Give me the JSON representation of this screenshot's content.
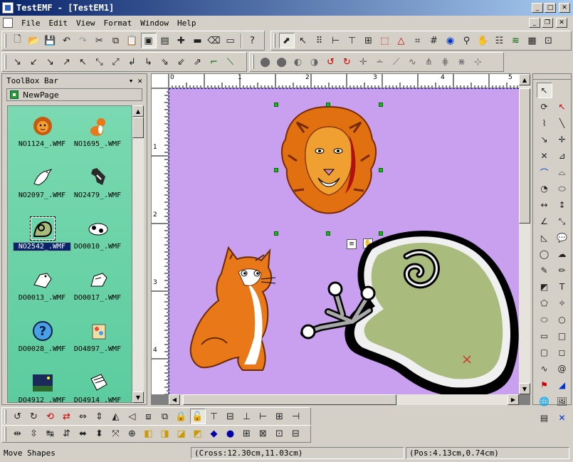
{
  "window": {
    "title": "TestEMF - [TestEM1]"
  },
  "menu": [
    {
      "key": "file",
      "label": "File"
    },
    {
      "key": "edit",
      "label": "Edit"
    },
    {
      "key": "view",
      "label": "View"
    },
    {
      "key": "format",
      "label": "Format"
    },
    {
      "key": "window",
      "label": "Window"
    },
    {
      "key": "help",
      "label": "Help"
    }
  ],
  "toolbox": {
    "title": "ToolBox Bar",
    "page_tab": "NewPage",
    "items": [
      {
        "label": "NO1124_.WMF",
        "icon": "lion-icon",
        "selected": false
      },
      {
        "label": "NO1695_.WMF",
        "icon": "cat-icon",
        "selected": false
      },
      {
        "label": "NO2097_.WMF",
        "icon": "bird-icon",
        "selected": false
      },
      {
        "label": "NO2479_.WMF",
        "icon": "horse-icon",
        "selected": false
      },
      {
        "label": "NO2542_.WMF",
        "icon": "frog-icon",
        "selected": true
      },
      {
        "label": "DO0010_.WMF",
        "icon": "cow-icon",
        "selected": false
      },
      {
        "label": "DO0013_.WMF",
        "icon": "dog-icon",
        "selected": false
      },
      {
        "label": "DO0017_.WMF",
        "icon": "dog-icon",
        "selected": false
      },
      {
        "label": "DO0028_.WMF",
        "icon": "question-icon",
        "selected": false
      },
      {
        "label": "DO4897_.WMF",
        "icon": "paint-icon",
        "selected": false
      },
      {
        "label": "DO4912_.WMF",
        "icon": "night-scene-icon",
        "selected": false
      },
      {
        "label": "DO4914_.WMF",
        "icon": "paper-icon",
        "selected": false
      }
    ]
  },
  "ruler": {
    "h_labels": [
      "0",
      "1",
      "2",
      "3",
      "4",
      "5"
    ],
    "v_labels": [
      "1",
      "2",
      "3",
      "4"
    ]
  },
  "status": {
    "message": "Move Shapes",
    "cross": "(Cross:12.30cm,11.03cm)",
    "pos": "(Pos:4.13cm,0.74cm)"
  },
  "colors": {
    "page_bg": "#c9a0f0",
    "thumb_bg": "#6ad4a6",
    "title_start": "#0a246a",
    "handle": "#1ab81a"
  }
}
